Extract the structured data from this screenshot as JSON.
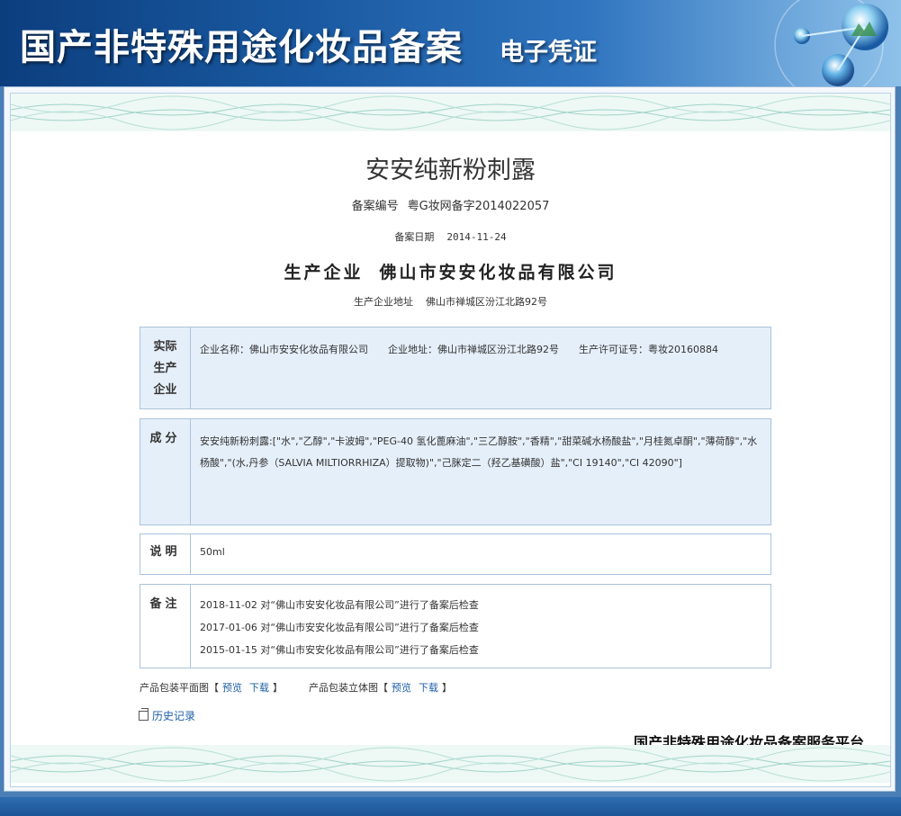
{
  "header": {
    "title": "国产非特殊用途化妆品备案",
    "subtitle": "电子凭证"
  },
  "certificate": {
    "product_name": "安安纯新粉刺露",
    "reg_no_label": "备案编号",
    "reg_no": "粤G妆网备字2014022057",
    "reg_date_label": "备案日期",
    "reg_date": "2014-11-24",
    "producer_label": "生产企业",
    "producer": "佛山市安安化妆品有限公司",
    "producer_addr_label": "生产企业地址",
    "producer_addr": "佛山市禅城区汾江北路92号"
  },
  "sections": {
    "factory": {
      "label": "实际生产企业",
      "name": "企业名称：佛山市安安化妆品有限公司",
      "address": "企业地址：佛山市禅城区汾江北路92号",
      "license": "生产许可证号：粤妆20160884"
    },
    "ingredients": {
      "label": "成分",
      "text": "安安纯新粉刺露:[\"水\",\"乙醇\",\"卡波姆\",\"PEG-40 氢化蓖麻油\",\"三乙醇胺\",\"香精\",\"甜菜碱水杨酸盐\",\"月桂氮卓酮\",\"薄荷醇\",\"水杨酸\",\"(水,丹参（SALVIA MILTIORRHIZA）提取物)\",\"己脒定二（羟乙基磺酸）盐\",\"CI 19140\",\"CI 42090\"]"
    },
    "description": {
      "label": "说明",
      "text": "50ml"
    },
    "remarks": {
      "label": "备注",
      "items": [
        "2018-11-02 对“佛山市安安化妆品有限公司”进行了备案后检查",
        "2017-01-06 对“佛山市安安化妆品有限公司”进行了备案后检查",
        "2015-01-15 对“佛山市安安化妆品有限公司”进行了备案后检查"
      ]
    }
  },
  "packaging": {
    "flat_label": "产品包装平面图",
    "solid_label": "产品包装立体图",
    "preview": "预览",
    "download": "下载",
    "bracket_open": "【",
    "bracket_close": "】"
  },
  "history": {
    "label": "历史记录",
    "icon": "external-window-icon"
  },
  "platform": "国产非特殊用途化妆品备案服务平台",
  "colors": {
    "header_dark": "#0c3e7e",
    "header_light": "#8fc2ea",
    "box_blue": "#e5eff9",
    "box_border": "#a9c4dd",
    "link": "#1d5fa6",
    "wave": "#9fd3c7"
  }
}
